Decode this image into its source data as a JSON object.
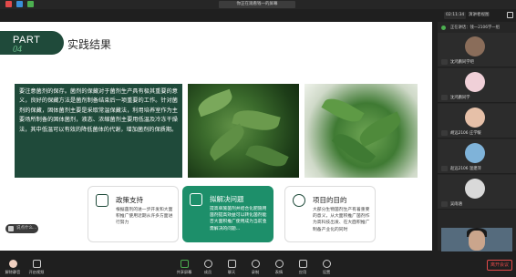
{
  "window": {
    "share_title": "你正在观看钱一的屏幕"
  },
  "subbar": {
    "timer": "02:11:34",
    "view_label": "演讲者视图"
  },
  "slide": {
    "part_label": "PART",
    "part_number": "04",
    "title": "实践结果",
    "body_text": "要注意菌剂的保存。菌剂的保藏对于菌剂生产具有极其重要的意义，良好的保藏方法是菌剂制备结束后一项重要的工作。针对菌剂的保藏，固体菌剂主要是采取常温保藏法，利用培养室作为主要场所制备的固体菌剂，液态、浓缩菌剂主要用低温及冷冻干燥法，其中低温可以有效的降低菌体的代谢，增加菌剂的保质期。",
    "cards": [
      {
        "title": "政策支持",
        "body": "根据菌剂的进一步开发和大面积推广使用近期从许多方面进行努力"
      },
      {
        "title": "拟解决问题",
        "body": "提高单施菌剂并结合化肥施用菌剂提高效益可以转化菌剂能否大面积推广使用成为当前亟需解决的问题..."
      },
      {
        "title": "项目的目的",
        "body": "大部分生物菌剂生产有着重要的意义，从大面积推广菌剂作为高科技出发、在大面积推广制备产业化的同时"
      }
    ]
  },
  "chat": {
    "placeholder": "说点什么..."
  },
  "right_panel": {
    "header": "正在讲话：钱一2106学一组",
    "participants": [
      {
        "name": "沈鸿鹏同学吧"
      },
      {
        "name": "沈鸿鹏同学"
      },
      {
        "name": "胡远2106 庄学暖"
      },
      {
        "name": "赵远2106 温建萍"
      },
      {
        "name": "吴雨涵"
      }
    ]
  },
  "toolbar": {
    "items": [
      {
        "label": "解除静音"
      },
      {
        "label": "开启视频"
      },
      {
        "label": "共享屏幕"
      },
      {
        "label": "成员"
      },
      {
        "label": "聊天"
      },
      {
        "label": "录制"
      },
      {
        "label": "表情"
      },
      {
        "label": "应用"
      },
      {
        "label": "设置"
      }
    ],
    "leave_label": "离开会议"
  },
  "colors": {
    "accent_green": "#1f4a3a",
    "card_highlight": "#1d8f6a",
    "leave_red": "#e24a4a"
  }
}
